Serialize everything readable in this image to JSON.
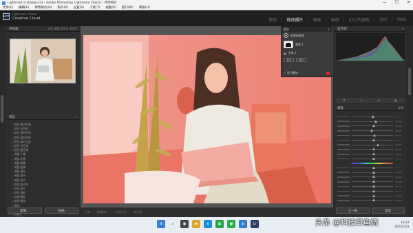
{
  "window": {
    "title": "Lightroom Catalog-v13 - Adobe Photoshop Lightroom Classic - 修改照片",
    "controls": [
      "—",
      "☐",
      "✕"
    ]
  },
  "menu": [
    "文件(F)",
    "编辑(E)",
    "修改照片(D)",
    "照片(P)",
    "设置(S)",
    "工具(T)",
    "视图(V)",
    "窗口(W)",
    "帮助(H)"
  ],
  "identity": {
    "badge": "Lrc",
    "line1": "Lightroom Classic",
    "line2": "Creative Cloud"
  },
  "modules": [
    "图库",
    "修改照片",
    "地图",
    "画册",
    "幻灯片放映",
    "打印",
    "Web"
  ],
  "active_module": "修改照片",
  "left": {
    "navigator_title": "导航器",
    "navigator_zoom": [
      "适合",
      "填满",
      "100%",
      "400%"
    ],
    "presets_title": "预设",
    "presets": [
      "颜色-黑白色调",
      "颜色-淡色调",
      "颜色-强烈色调",
      "颜色-柔和色调",
      "颜色-高对比度",
      "颜色-冷色调",
      "颜色-暖色调",
      "调整-人像",
      "调整-风景",
      "调整-美食",
      "调整-夜景",
      "调整-黑白",
      "调整-城市",
      "调整-室内",
      "颜色-复古色",
      "颜色-胶片",
      "颜色-电影",
      "效果-颗粒",
      "效果-暗角",
      "快照",
      "历史记录",
      "收藏夹",
      "用户预设"
    ],
    "copy_button": "复制...",
    "paste_button": "粘贴"
  },
  "mask_panel": {
    "title": "蒙版",
    "create_label": "创建新蒙版",
    "mask_name": "蒙版 1",
    "sub_name": "主体 1",
    "add_button": "添加",
    "subtract_button": "减去",
    "overlay_label": "显示叠加"
  },
  "toolbar": [
    "工具",
    "修改照片",
    "之前/之后",
    "软打样"
  ],
  "right": {
    "histogram_title": "直方图",
    "section": "蒙版",
    "reset": "重置",
    "copy_button": "上一张",
    "reset_button": "复位"
  },
  "taskbar": {
    "time": "13:23",
    "date": "2023/12/3"
  },
  "watermark": "头条 @科技章鱼烧"
}
